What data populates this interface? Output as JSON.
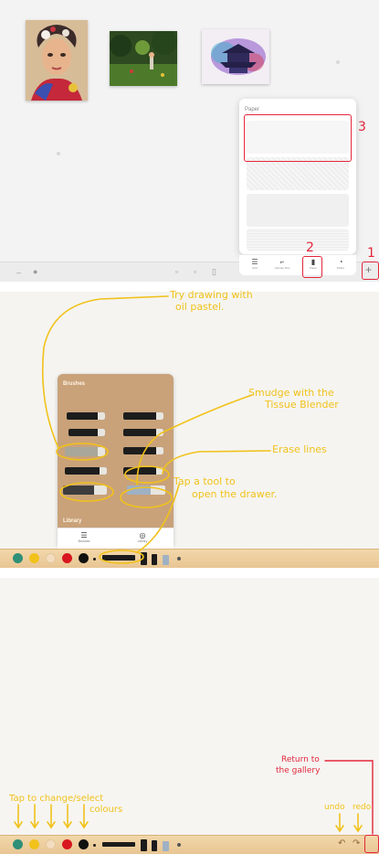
{
  "gallery": {
    "thumbnails": [
      {
        "name": "portrait painting"
      },
      {
        "name": "forest painting"
      },
      {
        "name": "temple watercolor"
      }
    ],
    "paper_popup": {
      "title": "Paper",
      "tabs": [
        {
          "label": "Grid",
          "icon": "grid-icon"
        },
        {
          "label": "Canvas Size",
          "icon": "canvas-size-icon"
        },
        {
          "label": "Paper",
          "icon": "paper-icon"
        },
        {
          "label": "Picker",
          "icon": "picker-icon"
        }
      ]
    },
    "callouts": {
      "one": "1",
      "two": "2",
      "three": "3"
    }
  },
  "brushes": {
    "section_brushes": "Brushes",
    "section_library": "Library",
    "tabs": [
      {
        "label": "Brushes",
        "icon": "brushes-icon"
      },
      {
        "label": "Library",
        "icon": "library-icon"
      }
    ],
    "notes": {
      "oil_pastel_line1": "Try drawing with",
      "oil_pastel_line2": "oil pastel.",
      "smudge_line1": "Smudge with the",
      "smudge_line2": "Tissue Blender",
      "erase": "Erase lines",
      "tap_tool_line1": "Tap a tool to",
      "tap_tool_line2": "open the drawer."
    }
  },
  "canvas": {
    "notes": {
      "colours_line1": "Tap to change/select",
      "colours_line2": "colours",
      "return_line1": "Return to",
      "return_line2": "the gallery",
      "undo": "undo",
      "redo": "redo"
    }
  },
  "palette": {
    "colors": [
      "#2f8f77",
      "#f2c21b",
      "#f4ddbf",
      "#d8161f",
      "#111111"
    ]
  },
  "colors": {
    "annotation_yellow": "#f1c21b",
    "annotation_red": "#e3263a",
    "wood": "#e8c593"
  }
}
